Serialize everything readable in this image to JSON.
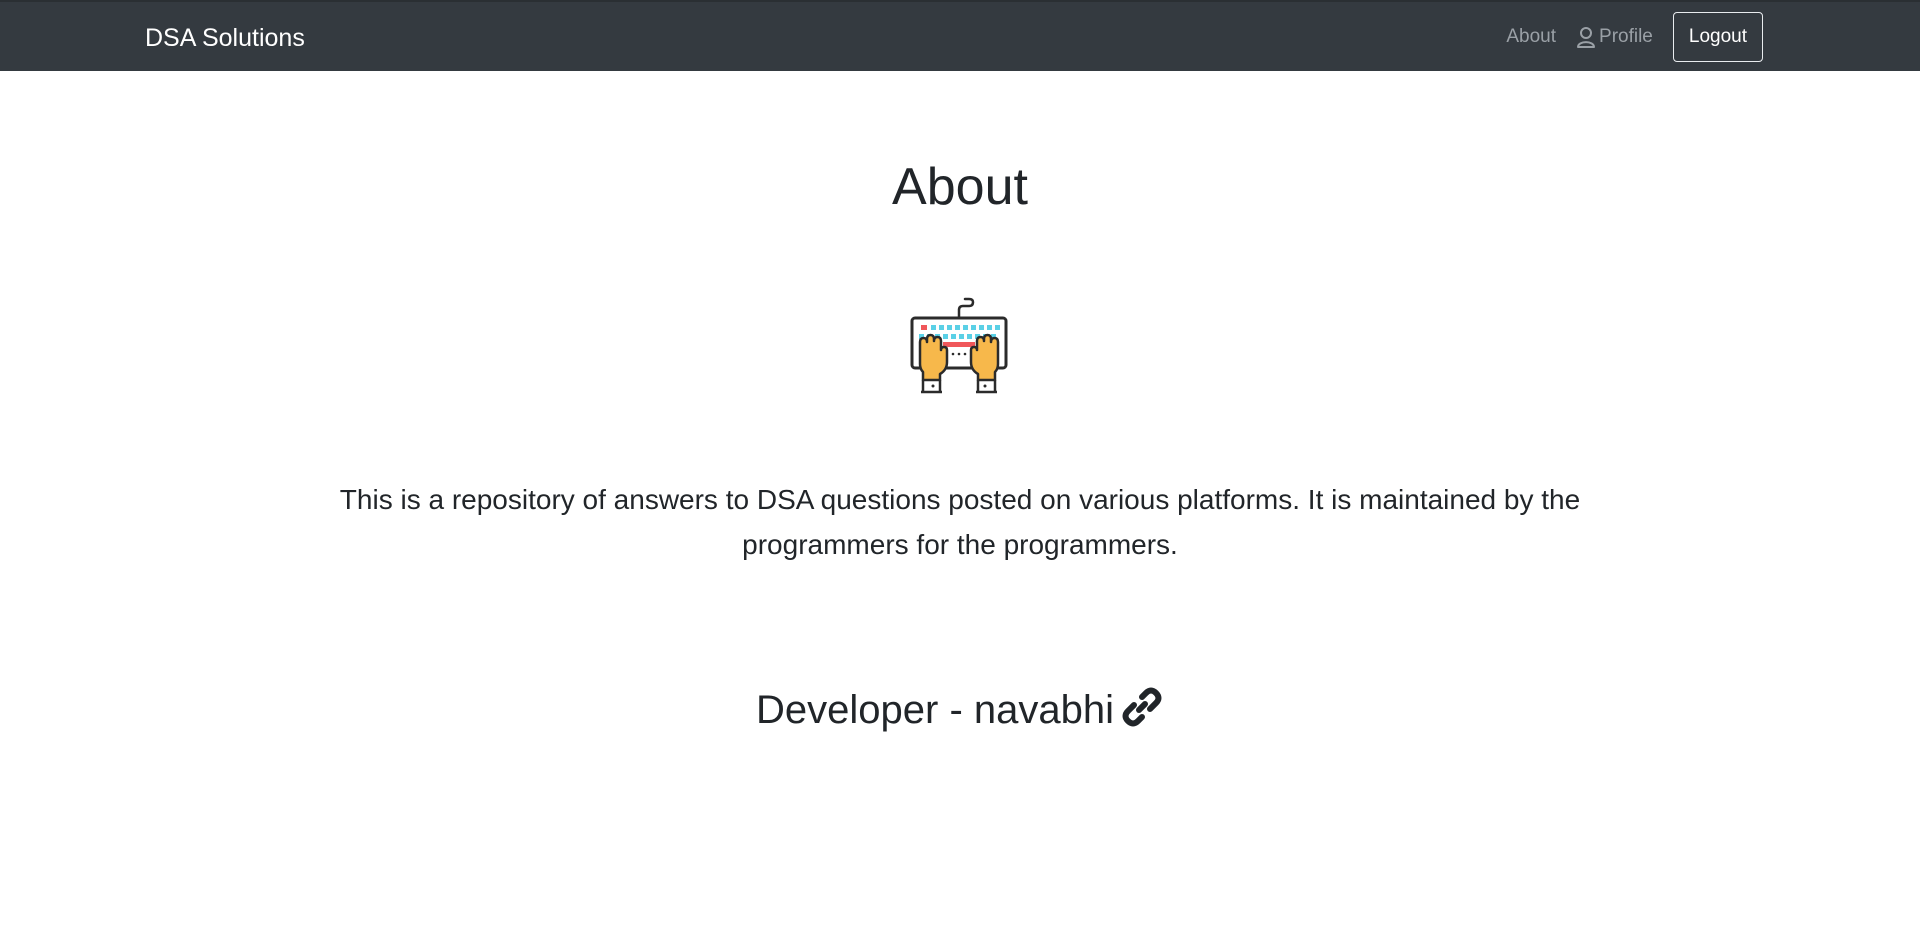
{
  "navbar": {
    "brand": "DSA Solutions",
    "links": [
      {
        "label": "About"
      },
      {
        "label": "Profile",
        "icon": "user-icon"
      }
    ],
    "logout_label": "Logout",
    "background": "#343a40"
  },
  "main": {
    "title": "About",
    "hero_icon": "keyboard-hands-icon",
    "description": "This is a repository of answers to DSA questions posted on various platforms. It is maintained by the programmers for the programmers.",
    "developer_text": "Developer - navabhi",
    "developer_link_icon": "link-icon"
  }
}
